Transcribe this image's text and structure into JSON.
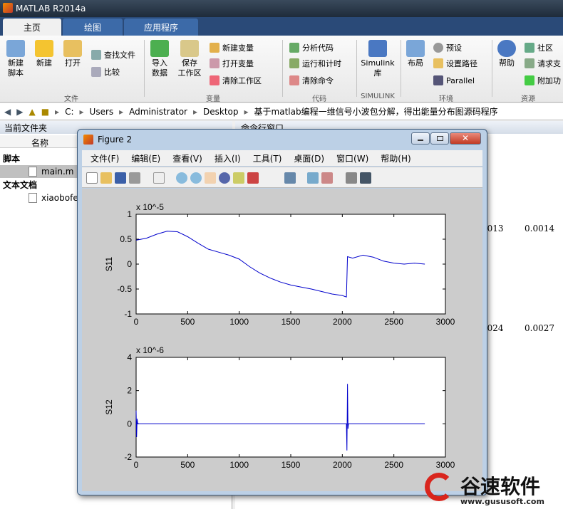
{
  "app": {
    "title": "MATLAB R2014a"
  },
  "tabs": [
    {
      "label": "主页"
    },
    {
      "label": "绘图"
    },
    {
      "label": "应用程序"
    }
  ],
  "ribbon": {
    "new_script": "新建\n脚本",
    "new": "新建",
    "open": "打开",
    "find_files": "查找文件",
    "compare": "比较",
    "group_file": "文件",
    "import_data": "导入\n数据",
    "save_ws": "保存\n工作区",
    "new_var": "新建变量",
    "open_var": "打开变量",
    "clear_ws": "清除工作区",
    "group_var": "变量",
    "analyze": "分析代码",
    "run_time": "运行和计时",
    "clear_cmd": "清除命令",
    "group_code": "代码",
    "simulink": "Simulink\n库",
    "group_simulink": "SIMULINK",
    "layout": "布局",
    "prefs": "预设",
    "set_path": "设置路径",
    "parallel": "Parallel",
    "group_env": "环境",
    "help": "帮助",
    "community": "社区",
    "request": "请求支",
    "addons": "附加功",
    "group_res": "资源"
  },
  "address": {
    "parts": [
      "C:",
      "Users",
      "Administrator",
      "Desktop",
      "基于matlab编程一维信号小波包分解，得出能量分布图源码程序"
    ]
  },
  "left_panel": {
    "title": "当前文件夹",
    "col_name": "名称",
    "group_scripts": "脚本",
    "file_main": "main.m",
    "group_docs": "文本文档",
    "file_txt": "xiaobofe"
  },
  "right_panel": {
    "title": "命令行窗口",
    "v1": "0013",
    "v2": "0.0014",
    "v3": "0024",
    "v4": "0.0027"
  },
  "figure": {
    "title": "Figure 2",
    "menu": [
      "文件(F)",
      "编辑(E)",
      "查看(V)",
      "插入(I)",
      "工具(T)",
      "桌面(D)",
      "窗口(W)",
      "帮助(H)"
    ]
  },
  "chart_data": [
    {
      "type": "line",
      "ylabel": "S11",
      "scale": "x 10^-5",
      "xlim": [
        0,
        3000
      ],
      "ylim": [
        -1,
        1
      ],
      "xticks": [
        0,
        500,
        1000,
        1500,
        2000,
        2500,
        3000
      ],
      "yticks": [
        -1,
        -0.5,
        0,
        0.5,
        1
      ],
      "series": [
        {
          "color": "#0000cc",
          "x": [
            0,
            100,
            200,
            300,
            400,
            500,
            600,
            700,
            800,
            900,
            1000,
            1100,
            1200,
            1300,
            1400,
            1500,
            1600,
            1700,
            1800,
            1900,
            2000,
            2040,
            2050,
            2100,
            2200,
            2300,
            2400,
            2500,
            2600,
            2700,
            2800
          ],
          "y": [
            0.48,
            0.52,
            0.6,
            0.66,
            0.65,
            0.55,
            0.42,
            0.3,
            0.24,
            0.18,
            0.1,
            -0.05,
            -0.18,
            -0.28,
            -0.36,
            -0.42,
            -0.46,
            -0.5,
            -0.55,
            -0.6,
            -0.63,
            -0.66,
            0.15,
            0.12,
            0.18,
            0.14,
            0.06,
            0.02,
            0.0,
            0.02,
            0.0
          ]
        }
      ]
    },
    {
      "type": "line",
      "ylabel": "S12",
      "scale": "x 10^-6",
      "xlim": [
        0,
        3000
      ],
      "ylim": [
        -2,
        4
      ],
      "xticks": [
        0,
        500,
        1000,
        1500,
        2000,
        2500,
        3000
      ],
      "yticks": [
        -2,
        0,
        2,
        4
      ],
      "series": [
        {
          "color": "#0000cc",
          "x": [
            0,
            5,
            10,
            15,
            20,
            500,
            1000,
            1500,
            2000,
            2040,
            2045,
            2050,
            2055,
            2060,
            2100,
            2500,
            2800
          ],
          "y": [
            0.8,
            -0.8,
            0.3,
            0,
            0,
            0,
            0,
            0,
            0,
            0,
            -1.6,
            2.4,
            -0.3,
            0,
            0,
            0,
            0
          ]
        }
      ]
    }
  ],
  "watermark": {
    "brand": "谷速软件",
    "url": "www.gususoft.com"
  }
}
